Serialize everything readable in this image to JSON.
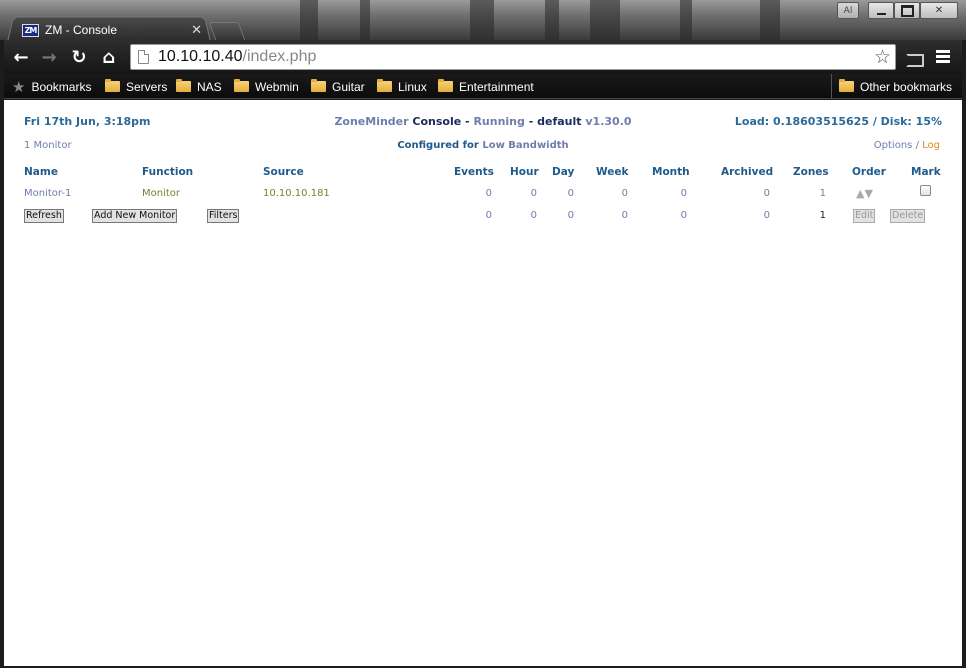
{
  "window": {
    "user_badge": "Al"
  },
  "tab": {
    "favicon": "ZM",
    "title": "ZM - Console"
  },
  "toolbar": {
    "url_host": "10.10.10.40",
    "url_path": "/index.php"
  },
  "bookmarks": {
    "label": "Bookmarks",
    "folders": [
      "Servers",
      "NAS",
      "Webmin",
      "Guitar",
      "Linux",
      "Entertainment"
    ],
    "other": "Other bookmarks"
  },
  "header": {
    "datetime": "Fri 17th Jun, 3:18pm",
    "app_name": "ZoneMinder",
    "page": "Console",
    "dash1": " - ",
    "state": "Running",
    "dash2": " - ",
    "run_state": "default",
    "version": "v1.30.0",
    "load": "Load: 0.18603515625 / Disk: 15%"
  },
  "subheader": {
    "monitor_count": "1 Monitor",
    "configured_prefix": "Configured for",
    "bandwidth": "Low Bandwidth",
    "options": "Options",
    "separator": " / ",
    "log": "Log"
  },
  "table": {
    "columns": [
      "Name",
      "Function",
      "Source",
      "Events",
      "Hour",
      "Day",
      "Week",
      "Month",
      "Archived",
      "Zones",
      "Order",
      "Mark"
    ],
    "monitor": {
      "name": "Monitor-1",
      "function": "Monitor",
      "source": "10.10.10.181",
      "events": "0",
      "hour": "0",
      "day": "0",
      "week": "0",
      "month": "0",
      "archived": "0",
      "zones": "1"
    },
    "totals": {
      "events": "0",
      "hour": "0",
      "day": "0",
      "week": "0",
      "month": "0",
      "archived": "0",
      "zones": "1"
    }
  },
  "buttons": {
    "refresh": "Refresh",
    "add_monitor": "Add New Monitor",
    "filters": "Filters",
    "edit": "Edit",
    "delete": "Delete"
  }
}
